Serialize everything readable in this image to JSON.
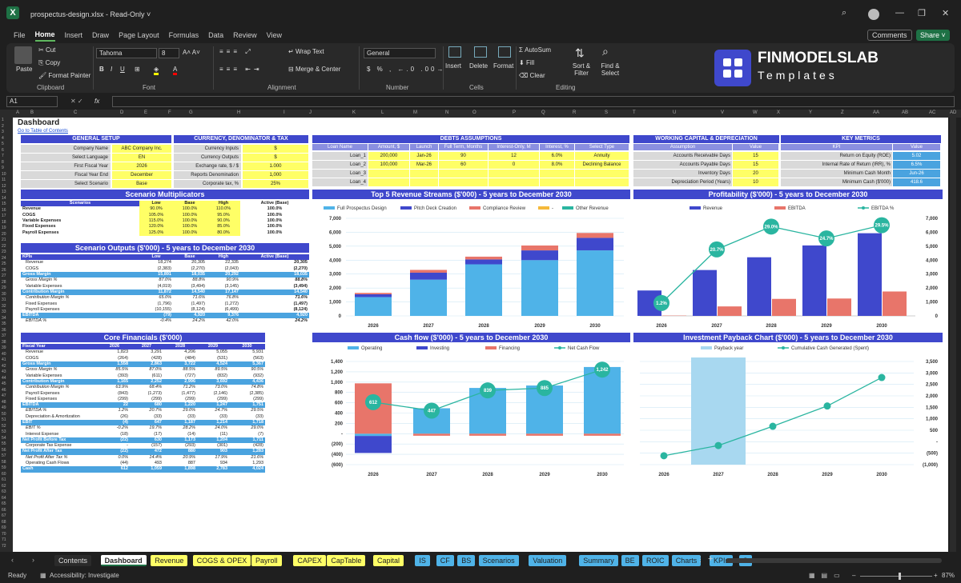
{
  "window": {
    "title": "prospectus-design.xlsx  -  Read-Only ˅",
    "search_icon": "search-icon",
    "avatar": "avatar",
    "minimize": "—",
    "maximize": "❐",
    "close": "✕"
  },
  "menu": {
    "tabs": [
      "File",
      "Home",
      "Insert",
      "Draw",
      "Page Layout",
      "Formulas",
      "Data",
      "Review",
      "View"
    ],
    "active": "Home",
    "comments": "Comments",
    "share": "Share ˅"
  },
  "ribbon": {
    "paste": "Paste",
    "cut": "Cut",
    "copy": "Copy",
    "format_painter": "Format Painter",
    "clipboard": "Clipboard",
    "font_name": "Tahoma",
    "font_size": "8",
    "font": "Font",
    "wrap_text": "Wrap Text",
    "merge_center": "Merge & Center",
    "alignment": "Alignment",
    "number_format": "General",
    "number": "Number",
    "insert": "Insert",
    "delete": "Delete",
    "format": "Format",
    "cells": "Cells",
    "autosum": "AutoSum",
    "fill": "Fill",
    "clear": "Clear",
    "sort_filter": "Sort & Filter",
    "find_select": "Find & Select",
    "editing": "Editing",
    "brand_line1": "FINMODELSLAB",
    "brand_line2": "Templates"
  },
  "formula_bar": {
    "name_box": "A1",
    "fx": "fx"
  },
  "columns": [
    "A",
    "B",
    "C",
    "D",
    "E",
    "F",
    "G",
    "H",
    "I",
    "J",
    "K",
    "L",
    "M",
    "N",
    "O",
    "P",
    "Q",
    "R",
    "S",
    "T",
    "U",
    "V",
    "W",
    "X",
    "Y",
    "Z",
    "AA",
    "AB",
    "AC",
    "AD"
  ],
  "sheet": {
    "title": "Dashboard",
    "link": "Go to Table of Contents",
    "general_setup": {
      "title": "GENERAL SETUP",
      "rows": [
        [
          "Company Name",
          "ABC Company Inc."
        ],
        [
          "Select Language",
          "EN"
        ],
        [
          "First Fiscal Year",
          "2026"
        ],
        [
          "Fiscal Year End",
          "December"
        ],
        [
          "Select Scenario",
          "Base"
        ]
      ]
    },
    "currency": {
      "title": "CURRENCY, DENOMINATOR & TAX",
      "rows": [
        [
          "Currency Inputs",
          "$"
        ],
        [
          "Currency Outputs",
          "$"
        ],
        [
          "Exchange rate, $ / $",
          "1.000"
        ],
        [
          "Reports Denomination",
          "1,000"
        ],
        [
          "Corporate tax, %",
          "25%"
        ]
      ]
    },
    "debts": {
      "title": "DEBTS ASSUMPTIONS",
      "headers": [
        "Loan Name",
        "Amount, $",
        "Launch",
        "Full Term, Months",
        "Interest-Only, M",
        "Interest, %",
        "Select Type"
      ],
      "rows": [
        [
          "Loan_1",
          "200,000",
          "Jan-26",
          "90",
          "12",
          "6.0%",
          "Annuity"
        ],
        [
          "Loan_2",
          "100,000",
          "Mar-26",
          "60",
          "0",
          "8.0%",
          "Declining Balance"
        ],
        [
          "Loan_3",
          "",
          "",
          "",
          "",
          "",
          ""
        ],
        [
          "Loan_4",
          "",
          "",
          "",
          "",
          "",
          ""
        ]
      ]
    },
    "wc": {
      "title": "WORKING CAPITAL & DEPRECIATION",
      "headers": [
        "Assumption",
        "Value"
      ],
      "rows": [
        [
          "Accounts Receivable Days",
          "15"
        ],
        [
          "Accounts Payable Days",
          "15"
        ],
        [
          "Inventory Days",
          "20"
        ],
        [
          "Depreciation Period (Years)",
          "10"
        ]
      ]
    },
    "kpi": {
      "title": "KEY METRICS",
      "headers": [
        "KPI",
        "Value"
      ],
      "rows": [
        [
          "Return on Equity (ROE)",
          "5.02"
        ],
        [
          "Internal Rate of Return (IRR), %",
          "6.5%"
        ],
        [
          "Minimum Cash Month",
          "Jun-26"
        ],
        [
          "Minimum Cash ($'000)",
          "418.6"
        ]
      ]
    },
    "scenario_mult": {
      "title": "Scenario Multiplicators",
      "headers": [
        "Scenarios",
        "Low",
        "Base",
        "High",
        "Active (Base)"
      ],
      "rows": [
        [
          "Revenue",
          "90.0%",
          "100.0%",
          "110.0%",
          "100.0%"
        ],
        [
          "COGS",
          "105.0%",
          "100.0%",
          "95.0%",
          "100.0%"
        ],
        [
          "Variable Expenses",
          "115.0%",
          "100.0%",
          "90.0%",
          "100.0%"
        ],
        [
          "Fixed Expenses",
          "120.0%",
          "100.0%",
          "85.0%",
          "100.0%"
        ],
        [
          "Payroll Expenses",
          "125.0%",
          "100.0%",
          "80.0%",
          "100.0%"
        ]
      ]
    },
    "scenario_out": {
      "title": "Scenario Outputs ($'000) - 5 years to December 2030",
      "headers": [
        "KPIs",
        "Low",
        "Base",
        "High",
        "Active (Base)"
      ],
      "rows": [
        [
          "Revenue",
          "18,274",
          "20,305",
          "22,335",
          "20,305",
          ""
        ],
        [
          "COGS",
          "(2,383)",
          "(2,270)",
          "(2,043)",
          "(2,270)",
          ""
        ],
        [
          "Gross Margin",
          "15,891",
          "18,035",
          "20,292",
          "18,035",
          "hl"
        ],
        [
          "Gross Margin %",
          "87.0%",
          "88.8%",
          "90.9%",
          "88.8%",
          "it"
        ],
        [
          "Variable Expenses",
          "(4,019)",
          "(3,494)",
          "(3,145)",
          "(3,494)",
          ""
        ],
        [
          "Contribution Margin",
          "11,872",
          "14,540",
          "17,147",
          "14,540",
          "hl"
        ],
        [
          "Contribution Margin %",
          "65.0%",
          "71.6%",
          "76.8%",
          "71.6%",
          "it"
        ],
        [
          "Fixed Expenses",
          "(1,796)",
          "(1,497)",
          "(1,272)",
          "(1,497)",
          ""
        ],
        [
          "Payroll Expenses",
          "(10,155)",
          "(8,124)",
          "(6,499)",
          "(8,124)",
          ""
        ],
        [
          "EBITDA",
          "(79)",
          "4,920",
          "9,376",
          "4,920",
          "hl"
        ],
        [
          "EBITDA %",
          "-0.4%",
          "24.2%",
          "42.0%",
          "24.2%",
          "it"
        ]
      ]
    },
    "core": {
      "title": "Core Financials ($'000)",
      "headers": [
        "Fiscal Year",
        "2026",
        "2027",
        "2028",
        "2029",
        "2030"
      ],
      "rows": [
        [
          "Revenue",
          "1,823",
          "3,291",
          "4,206",
          "5,055",
          "5,931",
          ""
        ],
        [
          "COGS",
          "(264)",
          "(428)",
          "(484)",
          "(531)",
          "(563)",
          ""
        ],
        [
          "Gross Margin",
          "1,558",
          "2,863",
          "3,722",
          "4,524",
          "5,367",
          "hl"
        ],
        [
          "Gross Margin %",
          "85.5%",
          "87.0%",
          "88.5%",
          "89.5%",
          "90.5%",
          "it"
        ],
        [
          "Variable Expenses",
          "(393)",
          "(611)",
          "(727)",
          "(832)",
          "(932)",
          ""
        ],
        [
          "Contribution Margin",
          "1,165",
          "2,252",
          "2,996",
          "3,692",
          "4,436",
          "hl"
        ],
        [
          "Contribution Margin %",
          "63.9%",
          "68.4%",
          "71.2%",
          "73.0%",
          "74.8%",
          "it"
        ],
        [
          "Payroll Expenses",
          "(843)",
          "(1,273)",
          "(1,477)",
          "(2,146)",
          "(2,385)",
          ""
        ],
        [
          "Fixed Expenses",
          "(299)",
          "(299)",
          "(299)",
          "(299)",
          "(299)",
          ""
        ],
        [
          "EBITDA",
          "22",
          "680",
          "1,220",
          "1,247",
          "1,751",
          "hl"
        ],
        [
          "EBITDA %",
          "1.2%",
          "20.7%",
          "29.0%",
          "24.7%",
          "29.5%",
          "it"
        ],
        [
          "Depreciation & Amortization",
          "(26)",
          "(33)",
          "(33)",
          "(33)",
          "(33)",
          ""
        ],
        [
          "EBIT",
          "(4)",
          "647",
          "1,187",
          "1,214",
          "1,718",
          "hl"
        ],
        [
          "EBIT %",
          "-0.2%",
          "19.7%",
          "28.2%",
          "24.0%",
          "29.0%",
          "it"
        ],
        [
          "Interest Expense",
          "(18)",
          "(17)",
          "(14)",
          "(11)",
          "(7)",
          ""
        ],
        [
          "Net Profit Before Tax",
          "(22)",
          "630",
          "1,173",
          "1,204",
          "1,711",
          "hl"
        ],
        [
          "Corporate Tax Expense",
          "-",
          "(157)",
          "(293)",
          "(301)",
          "(428)",
          ""
        ],
        [
          "Net Profit After Tax",
          "(22)",
          "472",
          "880",
          "903",
          "1,283",
          "hl"
        ],
        [
          "Net Profit After Tax %",
          "0.0%",
          "14.4%",
          "20.9%",
          "17.9%",
          "21.6%",
          "it"
        ],
        [
          "Operating Cash Flows",
          "(44)",
          "493",
          "887",
          "934",
          "1,293",
          ""
        ],
        [
          "Cash",
          "612",
          "1,059",
          "1,898",
          "2,783",
          "4,024",
          "hl"
        ]
      ]
    }
  },
  "chart_data": [
    {
      "type": "bar",
      "title": "Top 5 Revenue Streams ($'000) - 5 years to December 2030",
      "categories": [
        "2026",
        "2027",
        "2028",
        "2029",
        "2030"
      ],
      "ylim": [
        0,
        7000
      ],
      "yticks": [
        "0",
        "1,000",
        "2,000",
        "3,000",
        "4,000",
        "5,000",
        "6,000",
        "7,000"
      ],
      "series": [
        {
          "name": "Full Prospectus Design",
          "color": "#4fb3e8",
          "values": [
            1350,
            2600,
            3700,
            4000,
            4700
          ]
        },
        {
          "name": "Pitch Deck Creation",
          "color": "#3f48cc",
          "values": [
            200,
            500,
            350,
            700,
            900
          ]
        },
        {
          "name": "Compliance Review",
          "color": "#e8756a",
          "values": [
            100,
            200,
            200,
            350,
            350
          ]
        },
        {
          "name": "-",
          "color": "#f5b93b",
          "values": [
            0,
            0,
            0,
            0,
            0
          ]
        },
        {
          "name": "Other Revenue",
          "color": "#2ab5a0",
          "values": [
            0,
            0,
            0,
            0,
            0
          ]
        }
      ]
    },
    {
      "type": "bar",
      "title": "Profitability ($'000) - 5 years to December 2030",
      "categories": [
        "2026",
        "2027",
        "2028",
        "2029",
        "2030"
      ],
      "ylim": [
        0,
        7000
      ],
      "yticks": [
        "0",
        "1,000",
        "2,000",
        "3,000",
        "4,000",
        "5,000",
        "6,000",
        "7,000"
      ],
      "series": [
        {
          "name": "Revenue",
          "color": "#3f48cc",
          "values": [
            1823,
            3291,
            4206,
            5055,
            5931
          ]
        },
        {
          "name": "EBITDA",
          "color": "#e8756a",
          "values": [
            22,
            680,
            1220,
            1247,
            1751
          ]
        },
        {
          "name": "EBITDA %",
          "color": "#2ab5a0",
          "values": [
            1.2,
            20.7,
            29.0,
            24.7,
            29.5
          ],
          "labels": [
            "1.2%",
            "20.7%",
            "29.0%",
            "24.7%",
            "29.5%"
          ]
        }
      ]
    },
    {
      "type": "bar",
      "title": "Cash flow ($'000) - 5 years to December 2030",
      "categories": [
        "2026",
        "2027",
        "2028",
        "2029",
        "2030"
      ],
      "ylim": [
        -600,
        1400
      ],
      "yticks": [
        "(600)",
        "(400)",
        "(200)",
        "-",
        "200",
        "400",
        "600",
        "800",
        "1,000",
        "1,200",
        "1,400"
      ],
      "series": [
        {
          "name": "Operating",
          "color": "#4fb3e8",
          "values": [
            -44,
            493,
            887,
            934,
            1293
          ]
        },
        {
          "name": "Investing",
          "color": "#3f48cc",
          "values": [
            -330,
            0,
            0,
            0,
            0
          ]
        },
        {
          "name": "Financing",
          "color": "#e8756a",
          "values": [
            976,
            -40,
            -40,
            -40,
            -40
          ]
        },
        {
          "name": "Net Cash Flow",
          "color": "#2ab5a0",
          "values": [
            612,
            447,
            839,
            885,
            1242
          ],
          "labels": [
            "612",
            "447",
            "839",
            "885",
            "1,242"
          ]
        }
      ]
    },
    {
      "type": "line",
      "title": "Investment Payback Chart ($'000) - 5 years to December 2030",
      "categories": [
        "2026",
        "2027",
        "2028",
        "2029",
        "2030"
      ],
      "ylim": [
        -1000,
        3500
      ],
      "yticks": [
        "(1,000)",
        "(500)",
        "-",
        "500",
        "1,000",
        "1,500",
        "2,000",
        "2,500",
        "3,000",
        "3,500"
      ],
      "series": [
        {
          "name": "Payback year",
          "color": "#a8d8f0",
          "values": [
            0,
            1,
            0,
            0,
            0
          ]
        },
        {
          "name": "Cumulative Cash Generated (Spent)",
          "color": "#2ab5a0",
          "values": [
            -612,
            -165,
            674,
            1559,
            2801
          ]
        }
      ]
    }
  ],
  "tabs": {
    "items": [
      [
        "Contents",
        "#2b2b2b",
        "#ddd"
      ],
      [
        "Dashboard",
        "#ffffff",
        "#222"
      ],
      [
        "Revenue",
        "#ffff66",
        "#222"
      ],
      [
        "COGS & OPEX",
        "#ffff66",
        "#222"
      ],
      [
        "Payroll",
        "#ffff66",
        "#222"
      ],
      [
        "CAPEX",
        "#ffff66",
        "#222"
      ],
      [
        "CapTable",
        "#ffff66",
        "#222"
      ],
      [
        "Capital",
        "#ffff66",
        "#222"
      ],
      [
        "IS",
        "#4fb3e8",
        "#222"
      ],
      [
        "CF",
        "#4fb3e8",
        "#222"
      ],
      [
        "BS",
        "#4fb3e8",
        "#222"
      ],
      [
        "Scenarios",
        "#4fb3e8",
        "#222"
      ],
      [
        "Valuation",
        "#4fb3e8",
        "#222"
      ],
      [
        "Summary",
        "#4fb3e8",
        "#222"
      ],
      [
        "BE",
        "#4fb3e8",
        "#222"
      ],
      [
        "ROIC",
        "#4fb3e8",
        "#222"
      ],
      [
        "Charts",
        "#4fb3e8",
        "#222"
      ],
      [
        "KPIs",
        "#4fb3e8",
        "#222"
      ],
      [
        "S",
        "#4fb3e8",
        "#222"
      ]
    ],
    "add": "+",
    "more": "⋮"
  },
  "status": {
    "ready": "Ready",
    "accessibility": "Accessibility: Investigate",
    "zoom": "87%"
  }
}
